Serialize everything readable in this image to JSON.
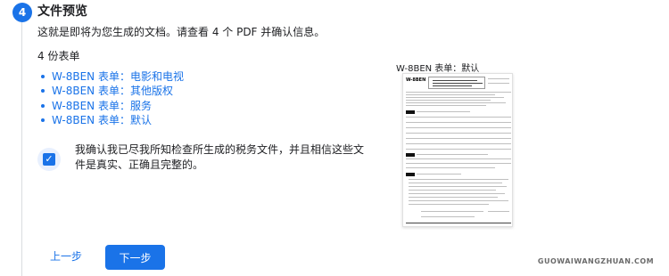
{
  "step": {
    "number": "4",
    "title": "文件预览",
    "intro": "这就是即将为您生成的文档。请查看 4 个 PDF 并确认信息。"
  },
  "forms": {
    "count_label": "4 份表单",
    "items": [
      {
        "label": "W-8BEN 表单：电影和电视"
      },
      {
        "label": "W-8BEN 表单：其他版权"
      },
      {
        "label": "W-8BEN 表单：服务"
      },
      {
        "label": "W-8BEN 表单：默认"
      }
    ]
  },
  "confirmation": {
    "checked": true,
    "text": "我确认我已尽我所知检查所生成的税务文件，并且相信这些文件是真实、正确且完整的。"
  },
  "preview": {
    "label": "W-8BEN 表单：默认",
    "form_name": "W-8BEN"
  },
  "buttons": {
    "prev_label": "上一步",
    "next_label": "下一步"
  },
  "watermark": "GUOWAIWANGZHUAN.COM",
  "colors": {
    "accent": "#1a73e8",
    "text": "#202124",
    "rail": "#dadce0"
  }
}
